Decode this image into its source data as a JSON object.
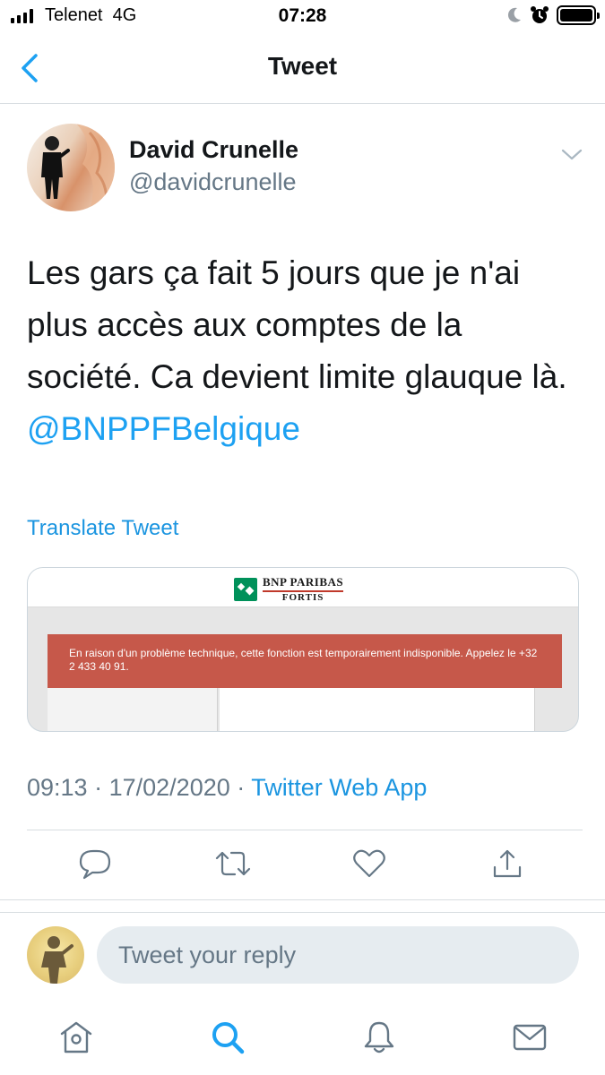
{
  "status_bar": {
    "carrier": "Telenet",
    "network": "4G",
    "time": "07:28",
    "battery_level": 1.0
  },
  "nav": {
    "title": "Tweet",
    "back_icon": "chevron-left-icon"
  },
  "tweet": {
    "author": {
      "display_name": "David Crunelle",
      "handle": "@davidcrunelle"
    },
    "text": "Les gars ça fait 5 jours que je n'ai plus accès aux comptes de la société. Ca devient limite glauque là.",
    "mention": "@BNPPFBelgique",
    "translate_label": "Translate Tweet",
    "media": {
      "brand_line1": "BNP PARIBAS",
      "brand_line2": "FORTIS",
      "error_message": "En raison d'un problème technique, cette fonction est temporairement indisponible. Appelez le +32 2 433 40 91."
    },
    "time": "09:13",
    "date": "17/02/2020",
    "separator": "·",
    "source": "Twitter Web App"
  },
  "actions": {
    "reply_icon": "comment-icon",
    "retweet_icon": "retweet-icon",
    "like_icon": "heart-icon",
    "share_icon": "share-icon"
  },
  "reply": {
    "placeholder": "Tweet your reply"
  },
  "tab_bar": {
    "items": [
      "home-icon",
      "search-icon",
      "notifications-icon",
      "messages-icon"
    ],
    "active": "search-icon"
  },
  "colors": {
    "accent": "#1da1f2",
    "link": "#1b95e0",
    "secondary_text": "#657786",
    "error_banner": "#c6584a",
    "bnp_green": "#00915a"
  }
}
